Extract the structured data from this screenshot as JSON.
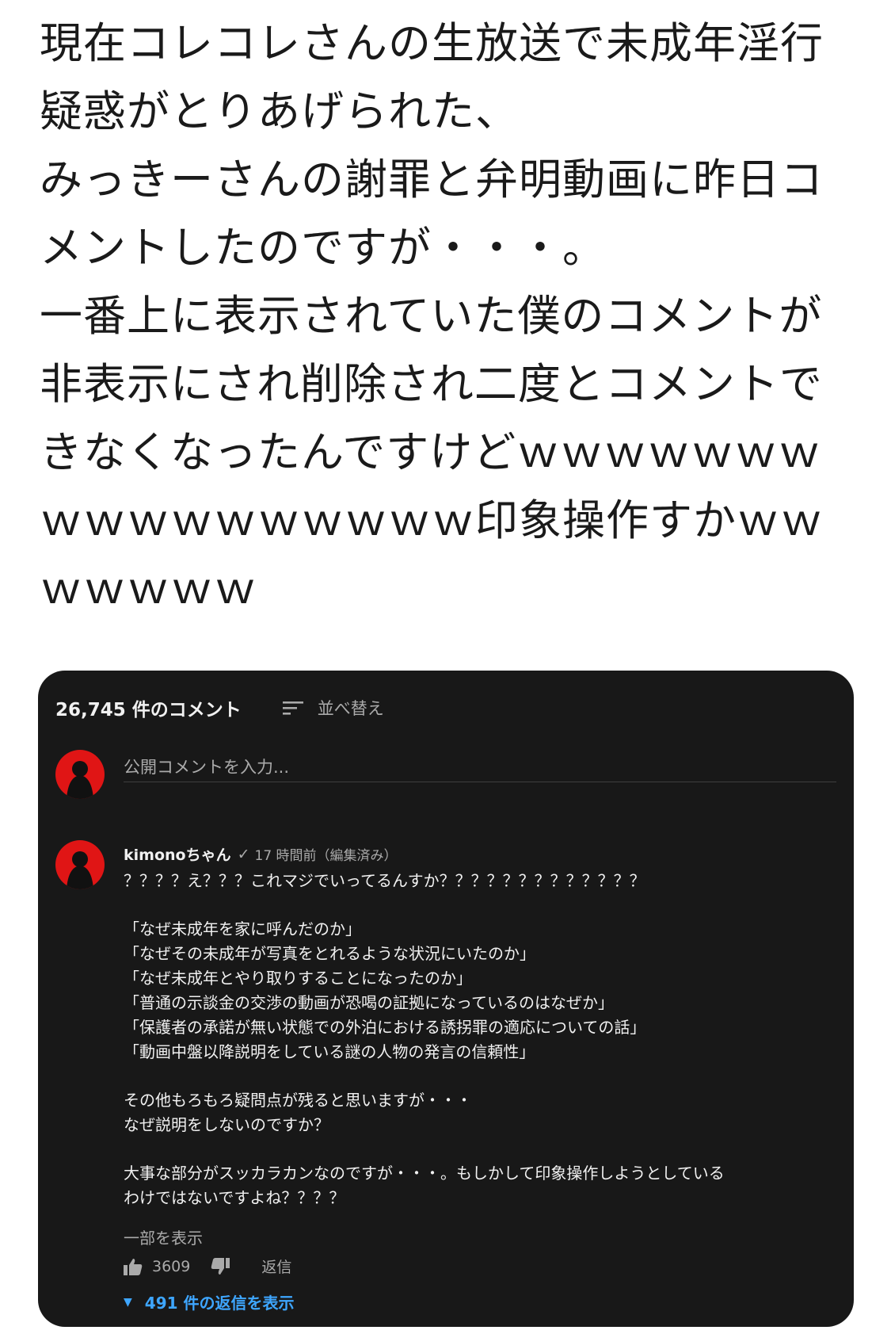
{
  "post": {
    "lines": [
      "現在コレコレさんの生放送で未成年淫行",
      "疑惑がとりあげられた、",
      "みっきーさんの謝罪と弁明動画に昨日コ",
      "メントしたのですが・・・。",
      "一番上に表示されていた僕のコメントが",
      "非表示にされ削除され二度とコメントで",
      "きなくなったんですけどｗｗｗｗｗｗｗ",
      "ｗｗｗｗｗｗｗｗｗｗ印象操作すかｗｗ",
      "ｗｗｗｗｗ"
    ]
  },
  "comments_panel": {
    "count_label": "26,745 件のコメント",
    "sort_label": "並べ替え",
    "input_placeholder": "公開コメントを入力...",
    "colors": {
      "background": "#181818",
      "avatar": "#e01515",
      "link": "#3ea6ff"
    }
  },
  "comment": {
    "author": "kimonoちゃん",
    "verified_mark": "✓",
    "time": "17 時間前（編集済み）",
    "paragraphs": [
      [
        "？？？？え？？？これマジでいってるんすか？？？？？？？？？？？？？"
      ],
      [
        "「なぜ未成年を家に呼んだのか」",
        "「なぜその未成年が写真をとれるような状況にいたのか」",
        "「なぜ未成年とやり取りすることになったのか」",
        "「普通の示談金の交渉の動画が恐喝の証拠になっているのはなぜか」",
        "「保護者の承諾が無い状態での外泊における誘拐罪の適応についての話」",
        "「動画中盤以降説明をしている謎の人物の発言の信頼性」"
      ],
      [
        "その他もろもろ疑問点が残ると思いますが・・・",
        "なぜ説明をしないのですか？"
      ],
      [
        "大事な部分がスッカラカンなのですが・・・。もしかして印象操作しようとしている",
        "わけではないですよね？？？？"
      ]
    ],
    "show_more": "一部を表示",
    "likes": "3609",
    "reply_label": "返信",
    "replies_label": "491 件の返信を表示"
  }
}
